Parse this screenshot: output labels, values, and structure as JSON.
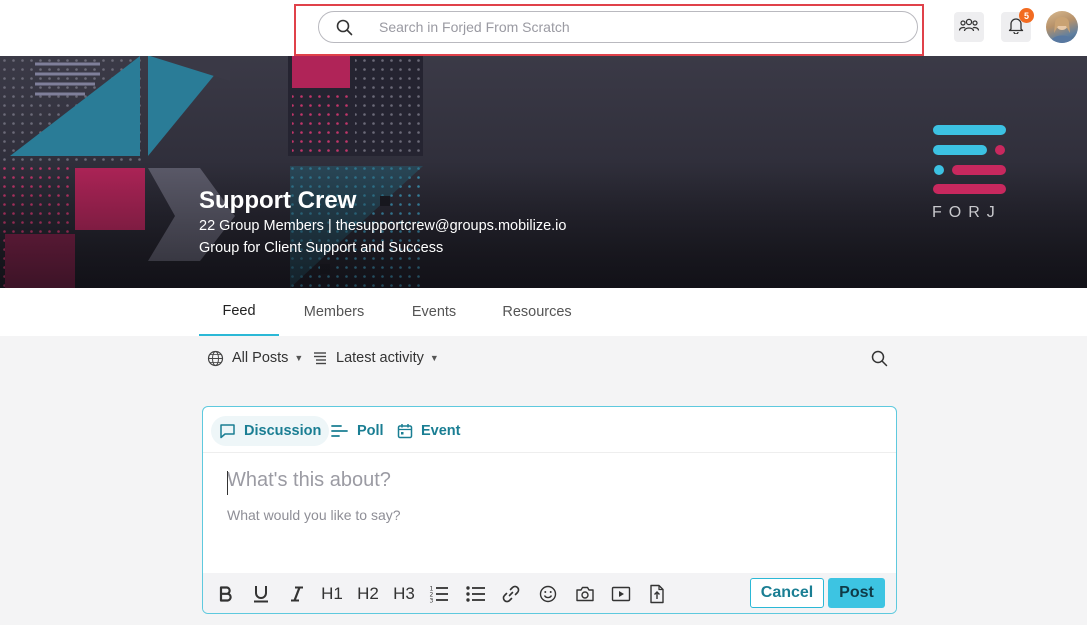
{
  "search": {
    "placeholder": "Search in Forjed From Scratch"
  },
  "header": {
    "notification_count": "5"
  },
  "group": {
    "title": "Support Crew",
    "meta": "22 Group Members | thesupportcrew@groups.mobilize.io",
    "description": "Group for Client Support and Success",
    "logo_text": "FORJ"
  },
  "tabs": [
    {
      "label": "Feed",
      "active": true
    },
    {
      "label": "Members",
      "active": false
    },
    {
      "label": "Events",
      "active": false
    },
    {
      "label": "Resources",
      "active": false
    }
  ],
  "filters": {
    "posts": "All Posts",
    "sort": "Latest activity"
  },
  "composer": {
    "types": [
      {
        "label": "Discussion",
        "active": true
      },
      {
        "label": "Poll",
        "active": false
      },
      {
        "label": "Event",
        "active": false
      }
    ],
    "title_placeholder": "What's this about?",
    "body_placeholder": "What would you like to say?",
    "toolbar": {
      "h1": "H1",
      "h2": "H2",
      "h3": "H3"
    },
    "cancel_label": "Cancel",
    "post_label": "Post"
  },
  "colors": {
    "accent": "#2bb8d6",
    "accent_dark": "#1a7e93",
    "badge": "#f26b21",
    "highlight": "#e0414a"
  }
}
